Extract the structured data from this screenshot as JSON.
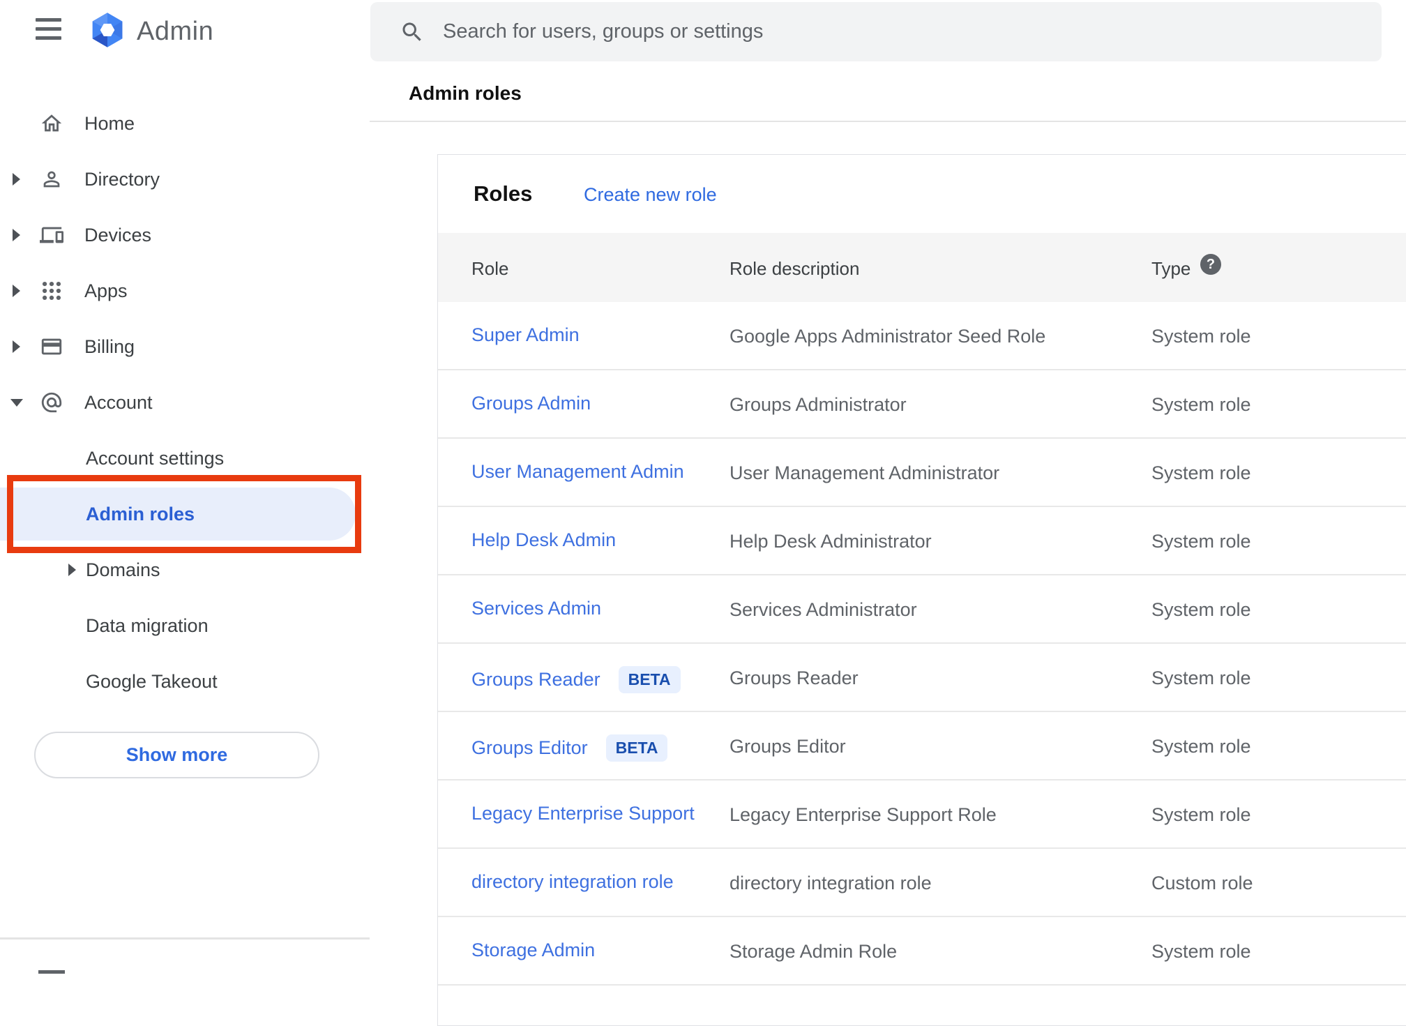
{
  "app": {
    "name": "Admin"
  },
  "topbar": {
    "search_placeholder": "Search for users, groups or settings"
  },
  "page": {
    "title": "Admin roles"
  },
  "sidebar": {
    "items": [
      {
        "label": "Home",
        "icon": "home"
      },
      {
        "label": "Directory",
        "icon": "person"
      },
      {
        "label": "Devices",
        "icon": "devices"
      },
      {
        "label": "Apps",
        "icon": "apps-grid"
      },
      {
        "label": "Billing",
        "icon": "credit-card"
      },
      {
        "label": "Account",
        "icon": "at-sign",
        "expanded": true
      }
    ],
    "account_children": [
      {
        "label": "Account settings"
      },
      {
        "label": "Admin roles",
        "selected": true,
        "annotated": "red-box"
      },
      {
        "label": "Domains"
      },
      {
        "label": "Data migration"
      },
      {
        "label": "Google Takeout"
      }
    ],
    "show_more_label": "Show more"
  },
  "content": {
    "card_title": "Roles",
    "create_link": "Create new role",
    "table": {
      "columns": [
        "Role",
        "Role description",
        "Type"
      ],
      "help_icon": "?",
      "rows": [
        {
          "role": "Super Admin",
          "description": "Google Apps Administrator Seed Role",
          "type": "System role"
        },
        {
          "role": "Groups Admin",
          "description": "Groups Administrator",
          "type": "System role"
        },
        {
          "role": "User Management Admin",
          "description": "User Management Administrator",
          "type": "System role"
        },
        {
          "role": "Help Desk Admin",
          "description": "Help Desk Administrator",
          "type": "System role"
        },
        {
          "role": "Services Admin",
          "description": "Services Administrator",
          "type": "System role"
        },
        {
          "role": "Groups Reader",
          "beta_label": "BETA",
          "description": "Groups Reader",
          "type": "System role"
        },
        {
          "role": "Groups Editor",
          "beta_label": "BETA",
          "description": "Groups Editor",
          "type": "System role"
        },
        {
          "role": "Legacy Enterprise Support",
          "description": "Legacy Enterprise Support Role",
          "type": "System role"
        },
        {
          "role": "directory integration role",
          "description": "directory integration role",
          "type": "Custom role"
        },
        {
          "role": "Storage Admin",
          "description": "Storage Admin Role",
          "type": "System role"
        }
      ]
    }
  },
  "colors": {
    "link_blue": "#3e70e0",
    "selected_text": "#2b5fd3",
    "selected_bg": "#e8eefb",
    "annotation_red": "#e83b0f",
    "beta_text": "#1a4fae",
    "beta_bg": "#e8f0fe",
    "header_band_bg": "#f5f5f5",
    "search_bg": "#f2f3f4",
    "icon_gray": "#5f6368",
    "logo_blue": "#4285f4"
  }
}
